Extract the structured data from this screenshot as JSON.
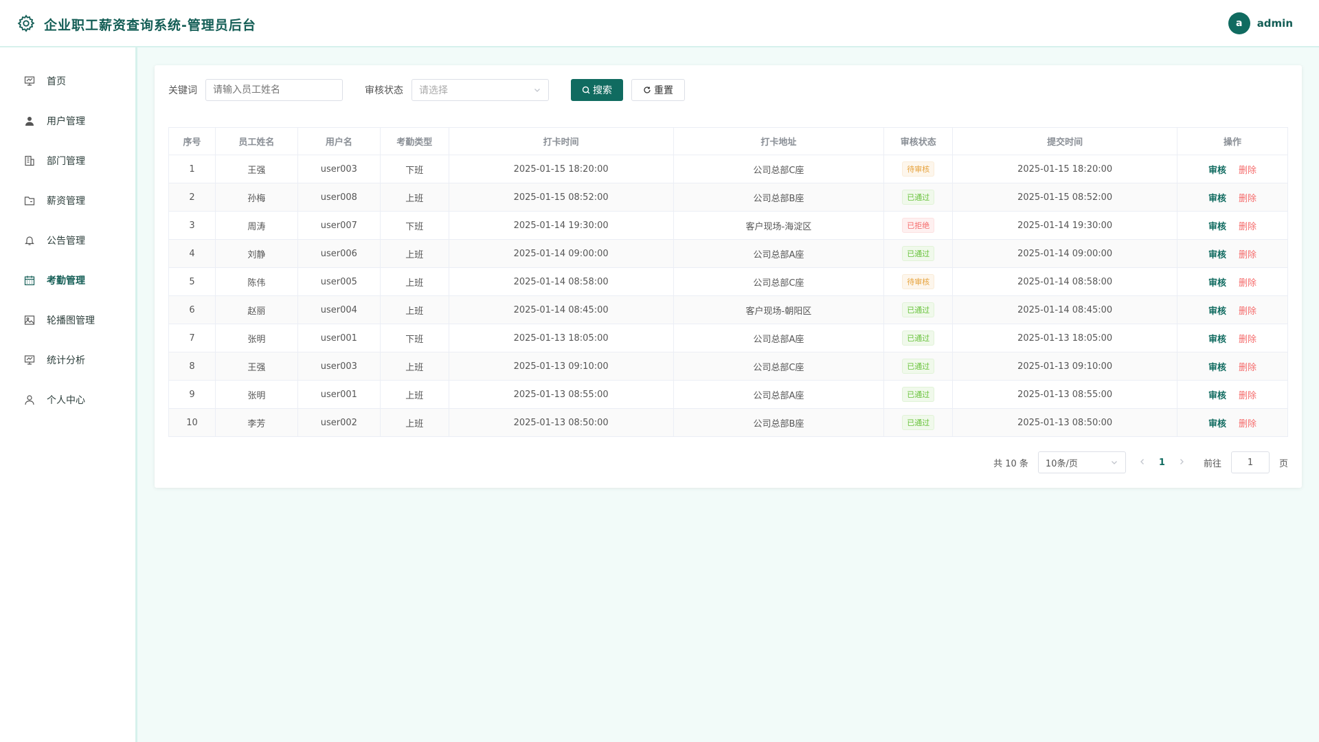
{
  "app": {
    "title": "企业职工薪资查询系统-管理员后台"
  },
  "user": {
    "avatar_letter": "a",
    "name": "admin"
  },
  "colors": {
    "primary": "#106b60",
    "danger": "#f56c6c",
    "warning": "#e6a23c",
    "success": "#67c23a"
  },
  "sidebar": {
    "items": [
      {
        "label": "首页",
        "icon": "dashboard-icon"
      },
      {
        "label": "用户管理",
        "icon": "user-icon"
      },
      {
        "label": "部门管理",
        "icon": "building-icon"
      },
      {
        "label": "薪资管理",
        "icon": "folder-icon"
      },
      {
        "label": "公告管理",
        "icon": "bell-icon"
      },
      {
        "label": "考勤管理",
        "icon": "calendar-icon",
        "active": true
      },
      {
        "label": "轮播图管理",
        "icon": "image-icon"
      },
      {
        "label": "统计分析",
        "icon": "chart-icon"
      },
      {
        "label": "个人中心",
        "icon": "person-icon"
      }
    ]
  },
  "filter": {
    "keyword_label": "关键词",
    "keyword_placeholder": "请输入员工姓名",
    "status_label": "审核状态",
    "status_placeholder": "请选择",
    "search_label": "搜索",
    "reset_label": "重置"
  },
  "table": {
    "headers": [
      "序号",
      "员工姓名",
      "用户名",
      "考勤类型",
      "打卡时间",
      "打卡地址",
      "审核状态",
      "提交时间",
      "操作"
    ],
    "action_approve": "审核",
    "action_delete": "删除",
    "rows": [
      {
        "no": "1",
        "name": "王强",
        "username": "user003",
        "type": "下班",
        "clock_time": "2025-01-15 18:20:00",
        "address": "公司总部C座",
        "status": "待审核",
        "status_kind": "pending",
        "submit_time": "2025-01-15 18:20:00"
      },
      {
        "no": "2",
        "name": "孙梅",
        "username": "user008",
        "type": "上班",
        "clock_time": "2025-01-15 08:52:00",
        "address": "公司总部B座",
        "status": "已通过",
        "status_kind": "approved",
        "submit_time": "2025-01-15 08:52:00"
      },
      {
        "no": "3",
        "name": "周涛",
        "username": "user007",
        "type": "下班",
        "clock_time": "2025-01-14 19:30:00",
        "address": "客户现场-海淀区",
        "status": "已拒绝",
        "status_kind": "rejected",
        "submit_time": "2025-01-14 19:30:00"
      },
      {
        "no": "4",
        "name": "刘静",
        "username": "user006",
        "type": "上班",
        "clock_time": "2025-01-14 09:00:00",
        "address": "公司总部A座",
        "status": "已通过",
        "status_kind": "approved",
        "submit_time": "2025-01-14 09:00:00"
      },
      {
        "no": "5",
        "name": "陈伟",
        "username": "user005",
        "type": "上班",
        "clock_time": "2025-01-14 08:58:00",
        "address": "公司总部C座",
        "status": "待审核",
        "status_kind": "pending",
        "submit_time": "2025-01-14 08:58:00"
      },
      {
        "no": "6",
        "name": "赵丽",
        "username": "user004",
        "type": "上班",
        "clock_time": "2025-01-14 08:45:00",
        "address": "客户现场-朝阳区",
        "status": "已通过",
        "status_kind": "approved",
        "submit_time": "2025-01-14 08:45:00"
      },
      {
        "no": "7",
        "name": "张明",
        "username": "user001",
        "type": "下班",
        "clock_time": "2025-01-13 18:05:00",
        "address": "公司总部A座",
        "status": "已通过",
        "status_kind": "approved",
        "submit_time": "2025-01-13 18:05:00"
      },
      {
        "no": "8",
        "name": "王强",
        "username": "user003",
        "type": "上班",
        "clock_time": "2025-01-13 09:10:00",
        "address": "公司总部C座",
        "status": "已通过",
        "status_kind": "approved",
        "submit_time": "2025-01-13 09:10:00"
      },
      {
        "no": "9",
        "name": "张明",
        "username": "user001",
        "type": "上班",
        "clock_time": "2025-01-13 08:55:00",
        "address": "公司总部A座",
        "status": "已通过",
        "status_kind": "approved",
        "submit_time": "2025-01-13 08:55:00"
      },
      {
        "no": "10",
        "name": "李芳",
        "username": "user002",
        "type": "上班",
        "clock_time": "2025-01-13 08:50:00",
        "address": "公司总部B座",
        "status": "已通过",
        "status_kind": "approved",
        "submit_time": "2025-01-13 08:50:00"
      }
    ]
  },
  "pagination": {
    "total_text": "共 10 条",
    "page_size": "10条/页",
    "current_page": "1",
    "goto_label": "前往",
    "goto_value": "1",
    "page_unit": "页"
  }
}
